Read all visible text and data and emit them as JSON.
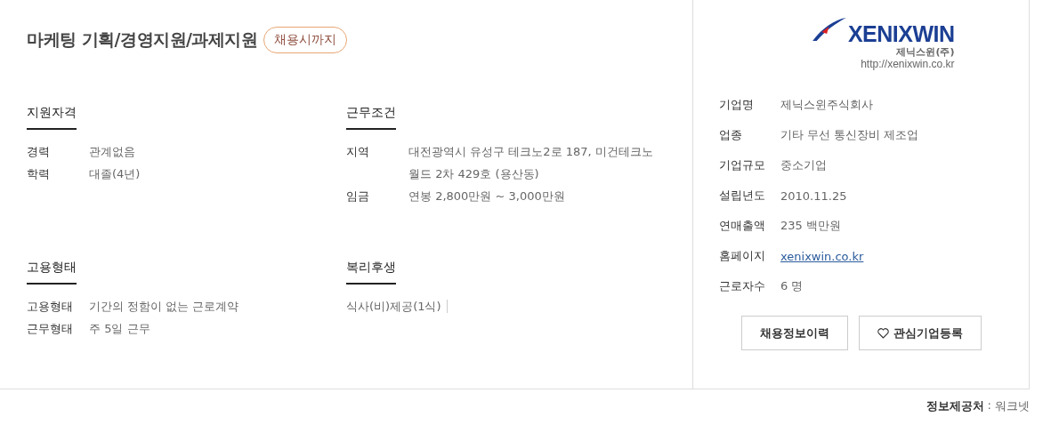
{
  "job": {
    "title": "마케팅 기획/경영지원/과제지원",
    "deadline_badge": "채용시까지"
  },
  "sections": [
    {
      "heading": "지원자격",
      "rows": [
        {
          "label": "경력",
          "value": "관계없음"
        },
        {
          "label": "학력",
          "value": "대졸(4년)"
        }
      ]
    },
    {
      "heading": "근무조건",
      "rows": [
        {
          "label": "지역",
          "value": "대전광역시 유성구 테크노2로 187, 미건테크노월드 2차 429호 (용산동)"
        },
        {
          "label": "임금",
          "value": "연봉 2,800만원 ~ 3,000만원"
        }
      ]
    },
    {
      "heading": "고용형태",
      "rows": [
        {
          "label": "고용형태",
          "value": "기간의 정함이 없는 근로계약"
        },
        {
          "label": "근무형태",
          "value": "주 5일 근무"
        }
      ]
    },
    {
      "heading": "복리후생",
      "tags": [
        "식사(비)제공(1식)"
      ]
    }
  ],
  "company": {
    "logo": {
      "wordmark": "XENIXWIN",
      "name": "제닉스윈(주)",
      "url": "http://xenixwin.co.kr"
    },
    "rows": [
      {
        "label": "기업명",
        "value": "제닉스윈주식회사",
        "kind": "text"
      },
      {
        "label": "업종",
        "value": "기타 무선 통신장비 제조업",
        "kind": "text"
      },
      {
        "label": "기업규모",
        "value": "중소기업",
        "kind": "text"
      },
      {
        "label": "설립년도",
        "value": "2010.11.25",
        "kind": "text"
      },
      {
        "label": "연매출액",
        "value": "235 백만원",
        "kind": "text"
      },
      {
        "label": "홈페이지",
        "value": "xenixwin.co.kr",
        "kind": "link"
      },
      {
        "label": "근로자수",
        "value": "6 명",
        "kind": "text"
      }
    ],
    "buttons": [
      {
        "label": "채용정보이력",
        "kind": "plain"
      },
      {
        "label": "관심기업등록",
        "kind": "favorite"
      }
    ]
  },
  "source": {
    "label": "정보제공처",
    "separator": ":",
    "value": "워크넷"
  }
}
